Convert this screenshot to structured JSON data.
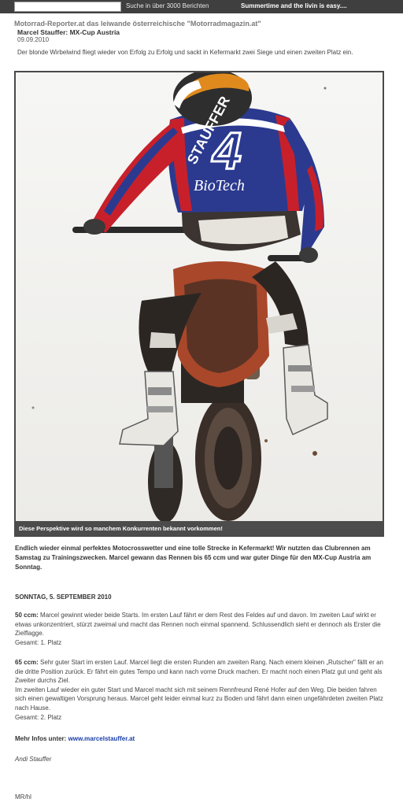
{
  "topbar": {
    "search_value": "",
    "search_label": "Suche in über 3000 Berichten",
    "slogan": "Summertime and the livin is easy...."
  },
  "header": {
    "site_title": "Motorrad-Reporter.at das leiwande österreichische \"Motorradmagazin.at\"",
    "article_title": "Marcel Stauffer: MX-Cup Austria",
    "date": "09.09.2010",
    "lead": "Der blonde Wirbelwind fliegt wieder von Erfolg zu Erfolg und sackt in Kefermarkt zwei Siege und einen zweiten Platz ein."
  },
  "photo": {
    "jersey_name": "STAUFFER",
    "jersey_number": "4",
    "jersey_sponsor": "BioTech",
    "caption": "Diese Perspektive wird so manchem Konkurrenten bekannt vorkommen!"
  },
  "article": {
    "intro": "Endlich wieder einmal perfektes Motocrosswetter und eine tolle Strecke in Kefermarkt! Wir nutzten das Clubrennen am Samstag zu Trainingszwecken. Marcel gewann das Rennen bis 65 ccm und war guter Dinge für den MX-Cup Austria am Sonntag.",
    "section_date": "SONNTAG, 5. SEPTEMBER 2010",
    "race1_label": "50 ccm:",
    "race1_text": "Marcel gewinnt wieder beide Starts. Im ersten Lauf fährt er dem Rest des Feldes auf und davon. Im zweiten Lauf wirkt er etwas unkonzentriert, stürzt zweimal und macht das Rennen noch einmal spannend. Schlussendlich sieht er dennoch als Erster die Zielflagge.",
    "race1_total": "Gesamt: 1. Platz",
    "race2_label": "65 ccm:",
    "race2_text_a": "Sehr guter Start im ersten Lauf. Marcel liegt die ersten Runden am zweiten Rang. Nach einem kleinen „Rutscher\" fällt er an die dritte Position zurück. Er fährt ein gutes Tempo und kann nach vorne Druck machen. Er macht noch einen Platz gut und geht als Zweiter durchs Ziel.",
    "race2_text_b": "Im zweiten Lauf wieder ein guter Start und Marcel macht sich mit seinem Rennfreund René Hofer auf den Weg. Die beiden fahren sich einen gewaltigen Vorsprung heraus. Marcel geht leider einmal kurz zu Boden und fährt dann einen ungefährdeten zweiten Platz nach Hause.",
    "race2_total": "Gesamt: 2. Platz",
    "more_label": "Mehr Infos unter:",
    "more_link": "www.marcelstauffer.at",
    "author": "Andi Stauffer",
    "signature": "MR/hl"
  },
  "colors": {
    "topbar": "#3f3f3f",
    "link": "#1a3ea8",
    "jersey_blue": "#2b3a8f",
    "jersey_red": "#c8202a"
  }
}
